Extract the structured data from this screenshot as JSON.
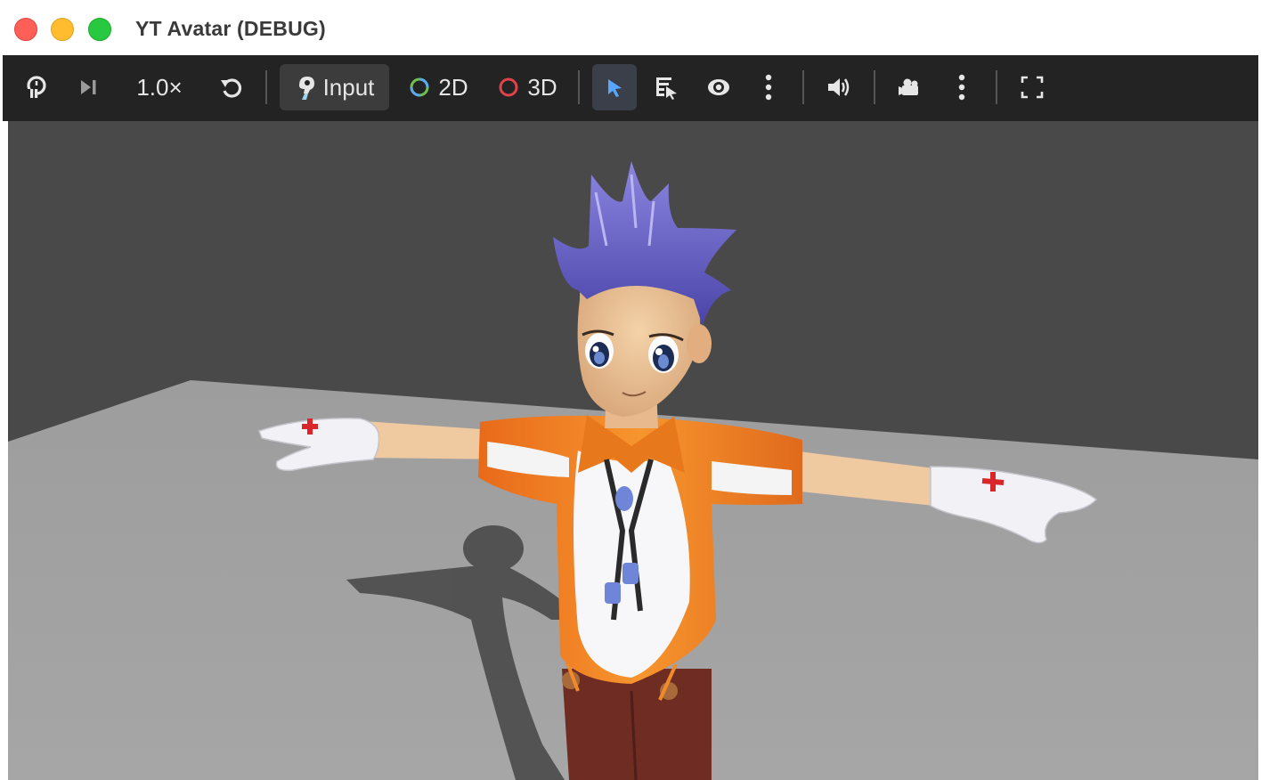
{
  "window": {
    "title": "YT Avatar (DEBUG)"
  },
  "toolbar": {
    "timescale_label": "1.0×",
    "input_label": "Input",
    "view_2d_label": "2D",
    "view_3d_label": "3D"
  },
  "icons": {
    "pause": "pause-icon",
    "step": "step-icon",
    "reload": "reload-icon",
    "input": "input-icon",
    "select": "cursor-arrow-icon",
    "list_select": "list-select-icon",
    "visibility": "eye-icon",
    "audio": "speaker-icon",
    "camera": "camera-icon",
    "more": "more-vertical-icon",
    "fullscreen": "fullscreen-icon"
  },
  "colors": {
    "toolbar_bg": "#232323",
    "viewport_bg": "#494949",
    "floor": "#a3a3a3",
    "selected_bg": "#3c3c3c",
    "select_tool_accent": "#58a6ff",
    "ring_2d": "#5aa9f0",
    "ring_3d": "#e0444a"
  }
}
